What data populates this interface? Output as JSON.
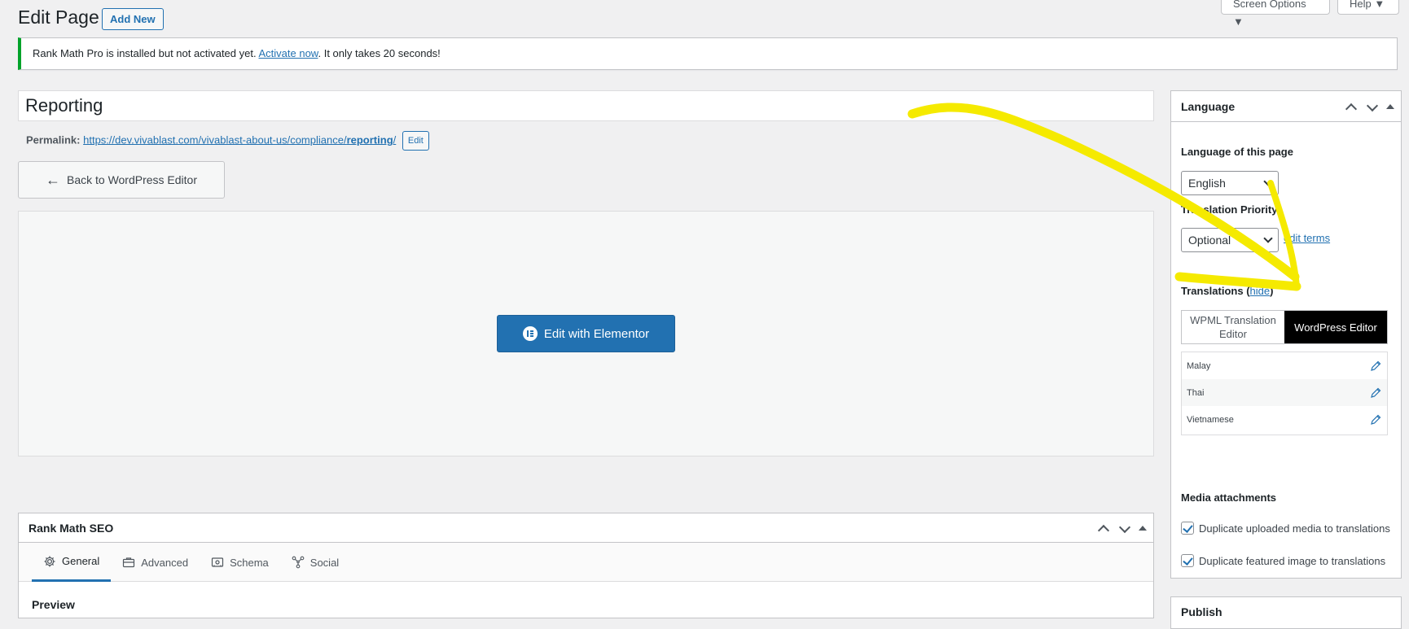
{
  "header": {
    "title": "Edit Page",
    "add_new": "Add New",
    "screen_options": "Screen Options ▼",
    "help": "Help ▼"
  },
  "notice": {
    "prefix": "Rank Math Pro is installed but not activated yet. ",
    "link": "Activate now",
    "suffix": ". It only takes 20 seconds!"
  },
  "post": {
    "title": "Reporting",
    "permalink_label": "Permalink:",
    "permalink_base": "https://dev.vivablast.com/vivablast-about-us/compliance/",
    "permalink_slug": "reporting",
    "permalink_trail": "/",
    "permalink_edit": "Edit"
  },
  "editor": {
    "back_label": "Back to WordPress Editor",
    "elementor_label": "Edit with Elementor"
  },
  "rankmath": {
    "title": "Rank Math SEO",
    "tabs": [
      "General",
      "Advanced",
      "Schema",
      "Social"
    ],
    "preview_label": "Preview"
  },
  "language": {
    "title": "Language",
    "lang_of_page_label": "Language of this page",
    "lang_value": "English",
    "priority_label": "Translation Priority",
    "priority_value": "Optional",
    "edit_terms": "edit terms",
    "translations_label": "Translations (",
    "translations_hide": "hide",
    "translations_close": ")",
    "segment": [
      "WPML Translation Editor",
      "WordPress Editor"
    ],
    "translations": [
      "Malay",
      "Thai",
      "Vietnamese"
    ],
    "media_label": "Media attachments",
    "dup_media": "Duplicate uploaded media to translations",
    "dup_featured": "Duplicate featured image to translations"
  },
  "publish": {
    "title": "Publish"
  },
  "colors": {
    "accent": "#2271b1",
    "notice_border": "#00a32a",
    "annotation": "#f5ea00"
  }
}
